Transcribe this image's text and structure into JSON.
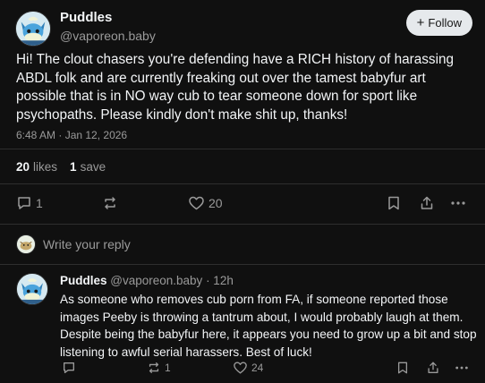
{
  "post": {
    "author_name": "Puddles",
    "author_handle": "@vaporeon.baby",
    "follow_label": "Follow",
    "body": "Hi! The clout chasers you're defending have a RICH history of harassing ABDL folk and are currently freaking out over the tamest babyfur art possible that is in NO way cub to tear someone down for sport like psychopaths. Please kindly don't make shit up, thanks!",
    "timestamp": "6:48 AM · Jan 12, 2026",
    "likes_count": "20",
    "likes_label": "likes",
    "saves_count": "1",
    "saves_label": "save",
    "reply_count": "1",
    "repost_count": "",
    "like_count": "20"
  },
  "reply_box": {
    "placeholder": "Write your reply"
  },
  "reply": {
    "author_name": "Puddles",
    "author_handle": "@vaporeon.baby",
    "time_ago": " · 12h",
    "body": "As someone who removes cub porn from FA, if someone reported those images Peeby is throwing a tantrum about, I would probably laugh at them. Despite being the babyfur here, it appears you need to grow up a bit and stop listening to awful serial harassers. Best of luck!",
    "reply_count": "",
    "repost_count": "1",
    "like_count": "24"
  },
  "icons": {
    "reply": "speech-bubble-icon",
    "repost": "repost-arrows-icon",
    "like": "heart-icon",
    "bookmark": "bookmark-icon",
    "share": "share-icon",
    "more": "ellipsis-icon"
  },
  "colors": {
    "background": "#101010",
    "text": "#f3f5f7",
    "muted": "#9a9a9a",
    "follow_bg": "#e6e9ec"
  }
}
